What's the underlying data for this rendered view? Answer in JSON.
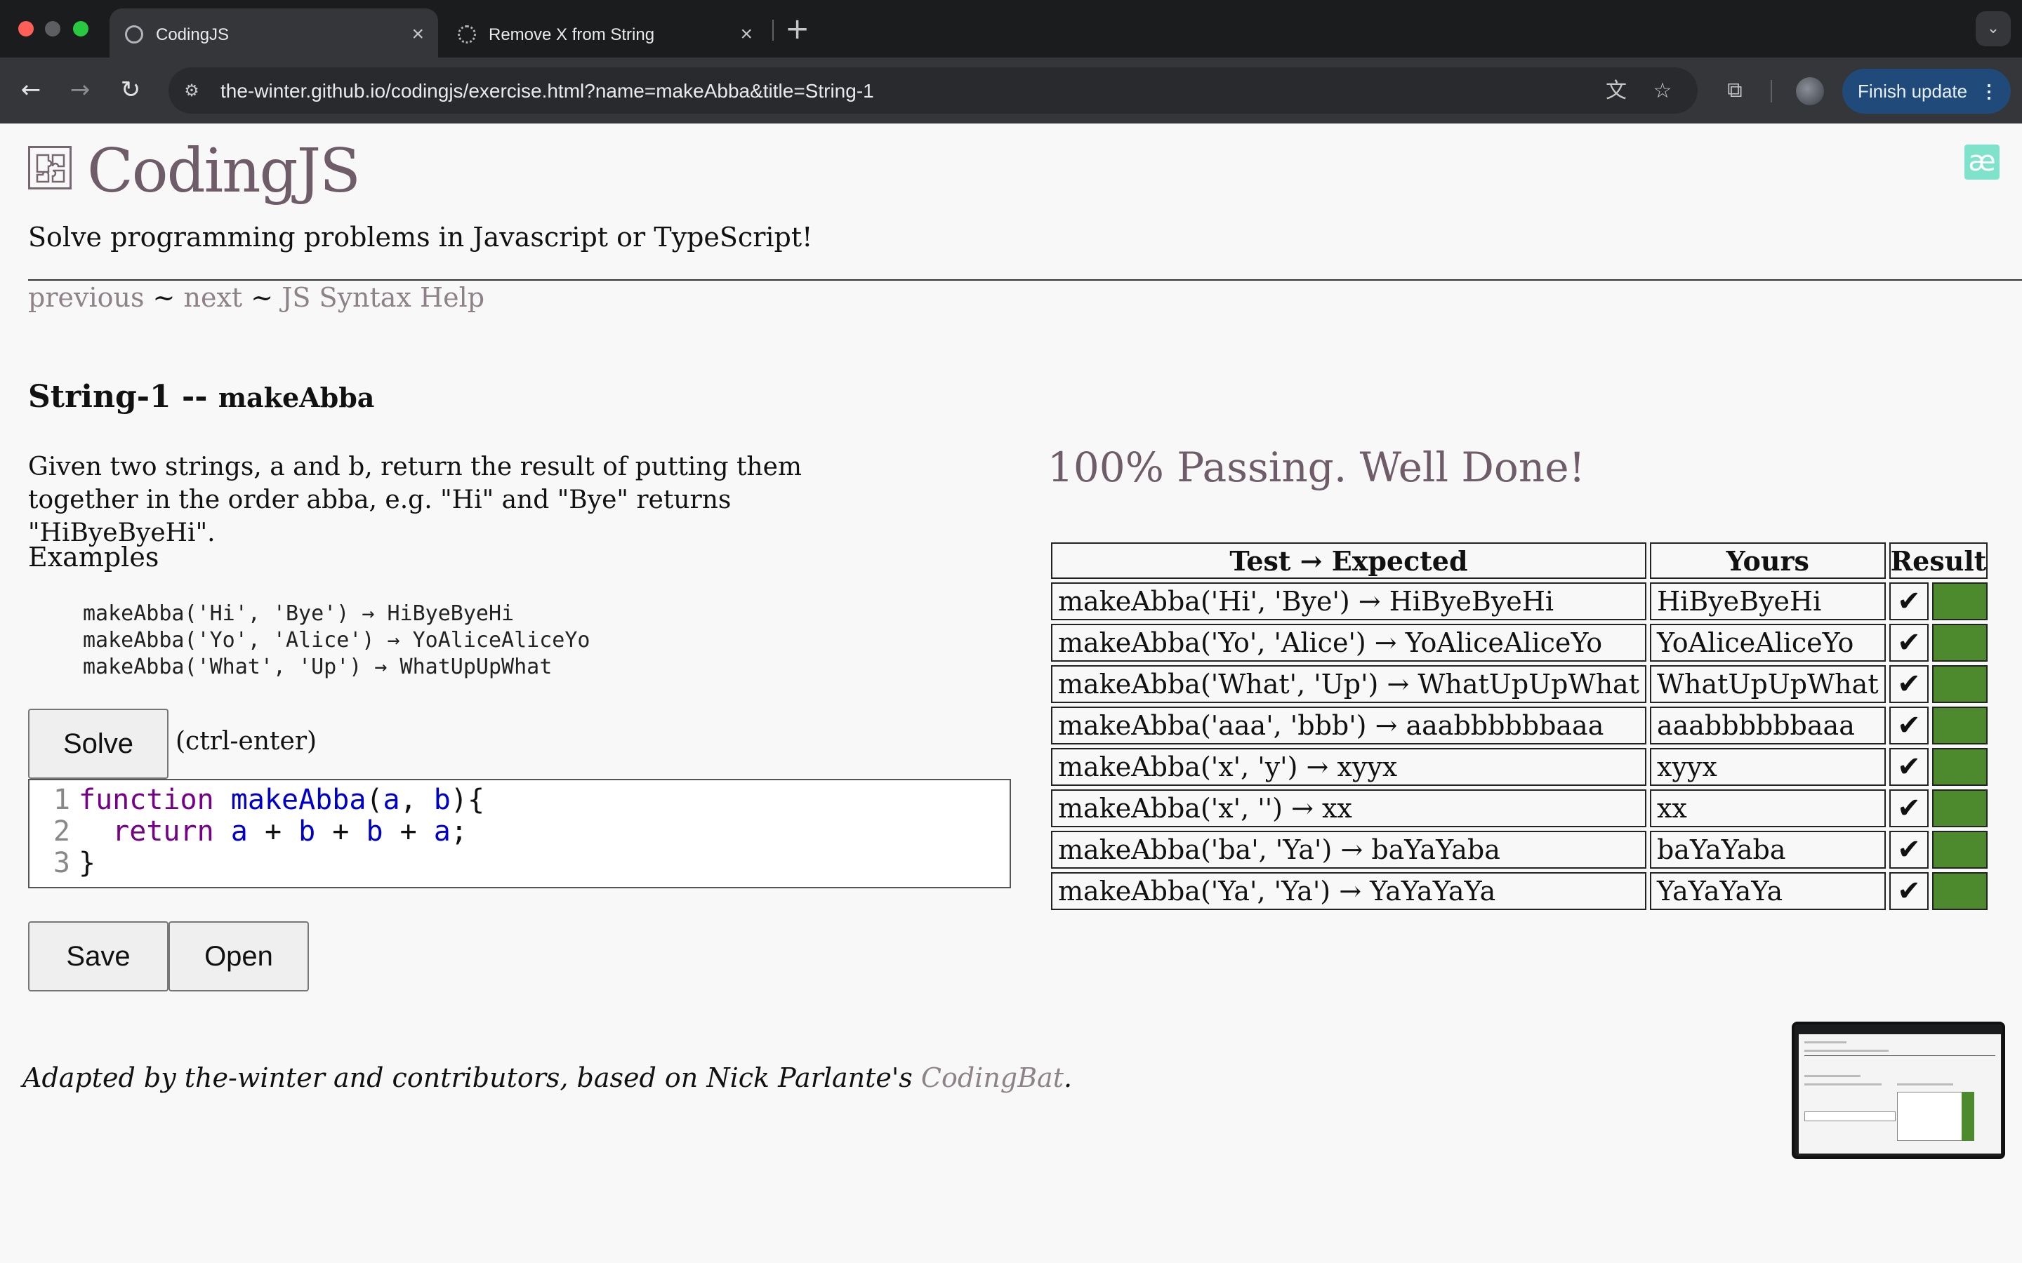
{
  "browser": {
    "tabs": [
      {
        "title": "CodingJS",
        "active": true
      },
      {
        "title": "Remove X from String",
        "active": false
      }
    ],
    "new_tab": "+",
    "url": "the-winter.github.io/codingjs/exercise.html?name=makeAbba&title=String-1",
    "update_button": "Finish update",
    "traffic_colors": [
      "#ff5f57",
      "#febc2e",
      "#28c840"
    ]
  },
  "site": {
    "title": "CodingJS",
    "tagline": "Solve programming problems in Javascript or TypeScript!",
    "badge": "æ"
  },
  "nav": {
    "previous": "previous",
    "next": "next",
    "sep": "~",
    "help": "JS Syntax Help"
  },
  "problem": {
    "category": "String-1 --",
    "name": "makeAbba",
    "description": "Given two strings, a and b, return the result of putting them together in the order abba, e.g. \"Hi\" and \"Bye\" returns \"HiByeByeHi\".",
    "examples_label": "Examples",
    "examples": [
      "makeAbba('Hi', 'Bye') → HiByeByeHi",
      "makeAbba('Yo', 'Alice') → YoAliceAliceYo",
      "makeAbba('What', 'Up') → WhatUpUpWhat"
    ]
  },
  "controls": {
    "solve": "Solve",
    "hint": "(ctrl-enter)",
    "save": "Save",
    "open": "Open"
  },
  "editor": {
    "line_numbers": [
      "1",
      "2",
      "3"
    ],
    "code": {
      "l1_kw": "function",
      "l1_fn": "makeAbba",
      "l1_open": "(",
      "l1_a": "a",
      "l1_comma": ", ",
      "l1_b": "b",
      "l1_close": "){",
      "l2_indent": "  ",
      "l2_kw": "return",
      "l2_rest": [
        " ",
        "a",
        " + ",
        "b",
        " + ",
        "b",
        " + ",
        "a",
        ";"
      ],
      "l3": "}"
    }
  },
  "results": {
    "status": "100% Passing. Well Done!",
    "headers": [
      "Test → Expected",
      "Yours",
      "Result"
    ],
    "rows": [
      {
        "test": "makeAbba('Hi', 'Bye') → HiByeByeHi",
        "yours": "HiByeByeHi",
        "mark": "✔"
      },
      {
        "test": "makeAbba('Yo', 'Alice') → YoAliceAliceYo",
        "yours": "YoAliceAliceYo",
        "mark": "✔"
      },
      {
        "test": "makeAbba('What', 'Up') → WhatUpUpWhat",
        "yours": "WhatUpUpWhat",
        "mark": "✔"
      },
      {
        "test": "makeAbba('aaa', 'bbb') → aaabbbbbbaaa",
        "yours": "aaabbbbbbaaa",
        "mark": "✔"
      },
      {
        "test": "makeAbba('x', 'y') → xyyx",
        "yours": "xyyx",
        "mark": "✔"
      },
      {
        "test": "makeAbba('x', '') → xx",
        "yours": "xx",
        "mark": "✔"
      },
      {
        "test": "makeAbba('ba', 'Ya') → baYaYaba",
        "yours": "baYaYaba",
        "mark": "✔"
      },
      {
        "test": "makeAbba('Ya', 'Ya') → YaYaYaYa",
        "yours": "YaYaYaYa",
        "mark": "✔"
      }
    ],
    "pass_color": "#4d8a2e"
  },
  "footer": {
    "prefix": "Adapted by the-winter and contributors, based on Nick Parlante's ",
    "link": "CodingBat",
    "suffix": "."
  }
}
